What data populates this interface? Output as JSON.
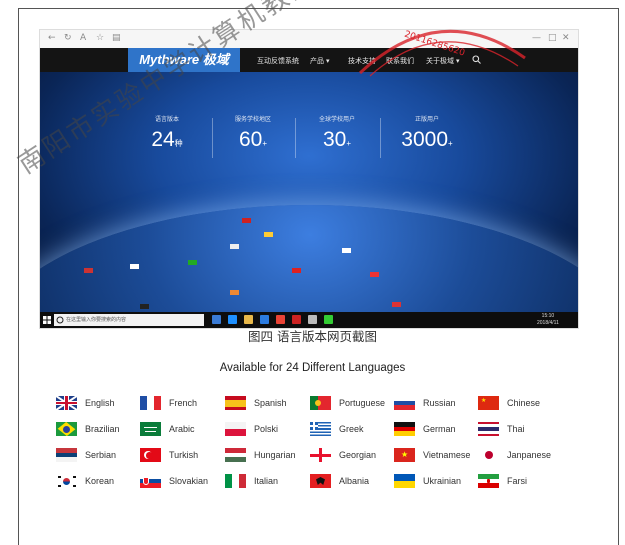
{
  "browser": {
    "controls": [
      "←",
      "↻",
      "A",
      "☆",
      "▤"
    ],
    "right_controls": [
      "—",
      "□",
      "✕"
    ]
  },
  "nav": {
    "logo": "Mythware 极域",
    "items": [
      "互动反馈系统",
      "产品 ▾",
      "技术支持",
      "联系我们",
      "关于极域 ▾"
    ]
  },
  "stats": [
    {
      "label": "语言版本",
      "value": "24",
      "unit": "种"
    },
    {
      "label": "服务学校地区",
      "value": "60",
      "unit": "+"
    },
    {
      "label": "全球学校用户",
      "value": "30",
      "unit": "+"
    },
    {
      "label": "正版用户",
      "value": "3000",
      "unit": "+"
    }
  ],
  "taskbar": {
    "search_placeholder": "在这里输入你要搜索的内容",
    "time": "15:10",
    "date": "2018/4/11"
  },
  "stamp_text": "20116285620",
  "watermark_text": "南阳市实验中学计算机教室升级改造及",
  "caption": "图四  语言版本网页截图",
  "languages_title": "Available for 24 Different Languages",
  "languages": [
    {
      "name": "English",
      "flag": "uk"
    },
    {
      "name": "French",
      "flag": "fr"
    },
    {
      "name": "Spanish",
      "flag": "es"
    },
    {
      "name": "Portuguese",
      "flag": "pt"
    },
    {
      "name": "Russian",
      "flag": "ru"
    },
    {
      "name": "Chinese",
      "flag": "cn"
    },
    {
      "name": "Brazilian",
      "flag": "br"
    },
    {
      "name": "Arabic",
      "flag": "sa"
    },
    {
      "name": "Polski",
      "flag": "pl"
    },
    {
      "name": "Greek",
      "flag": "gr"
    },
    {
      "name": "German",
      "flag": "de"
    },
    {
      "name": "Thai",
      "flag": "th"
    },
    {
      "name": "Serbian",
      "flag": "rs"
    },
    {
      "name": "Turkish",
      "flag": "tr"
    },
    {
      "name": "Hungarian",
      "flag": "hu"
    },
    {
      "name": "Georgian",
      "flag": "ge"
    },
    {
      "name": "Vietnamese",
      "flag": "vn"
    },
    {
      "name": "Janpanese",
      "flag": "jp"
    },
    {
      "name": "Korean",
      "flag": "kr"
    },
    {
      "name": "Slovakian",
      "flag": "sk"
    },
    {
      "name": "Italian",
      "flag": "it"
    },
    {
      "name": "Albania",
      "flag": "al"
    },
    {
      "name": "Ukrainian",
      "flag": "ua"
    },
    {
      "name": "Farsi",
      "flag": "ir"
    }
  ],
  "colors": {
    "logo_blue": "#2f74c9",
    "navbar": "#141414",
    "stamp_red": "#d9232b"
  }
}
